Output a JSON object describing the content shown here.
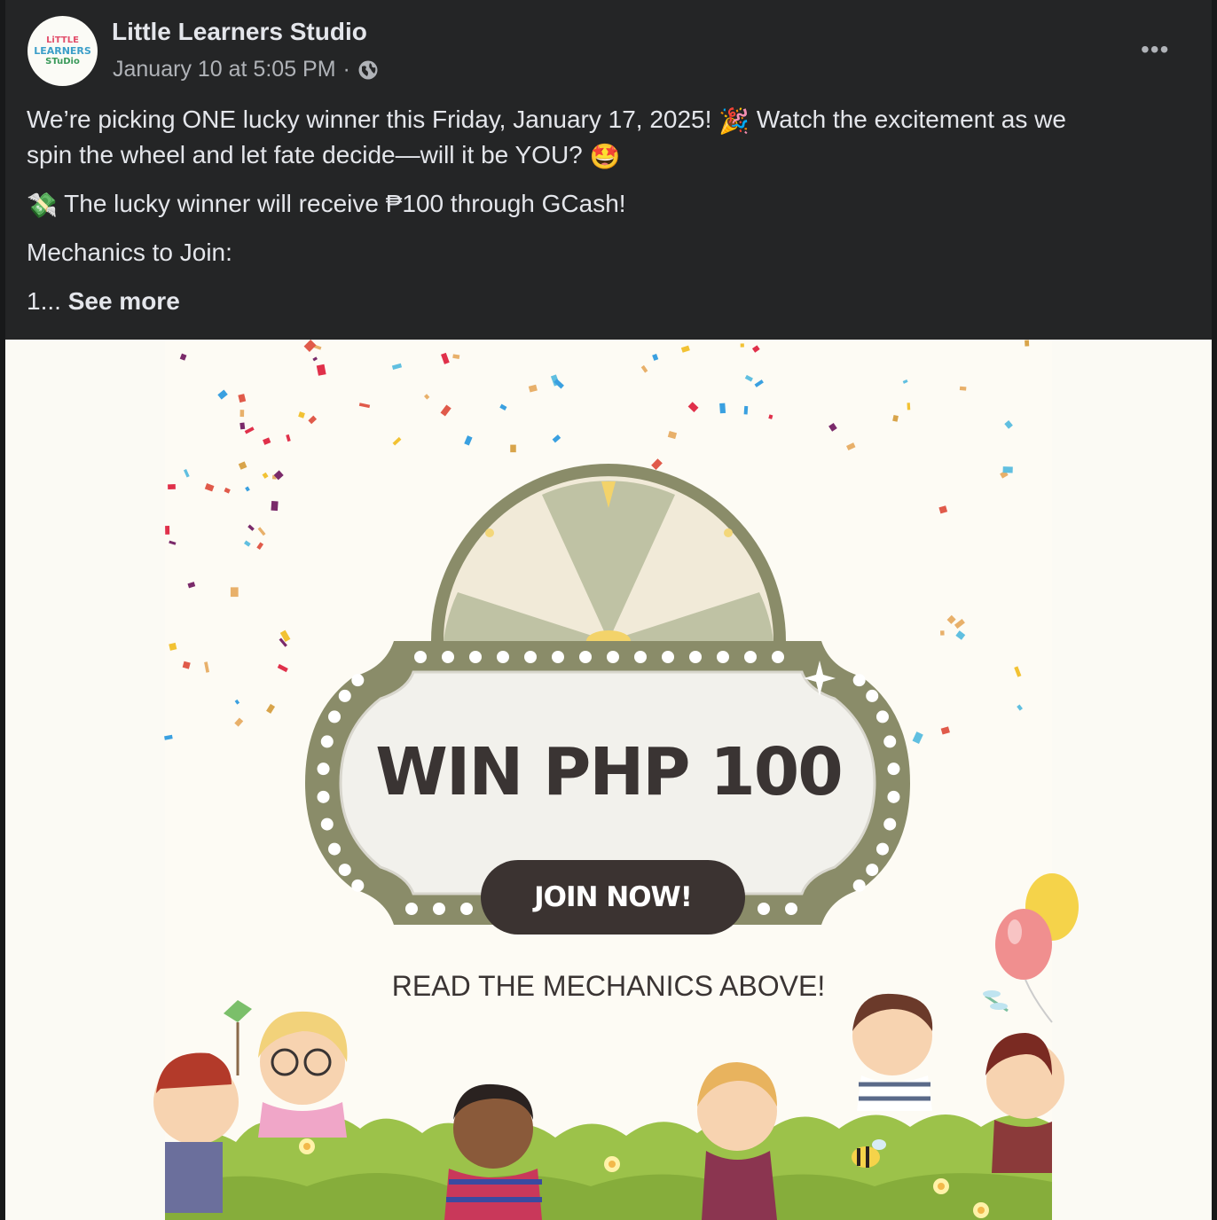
{
  "post": {
    "page_name": "Little Learners Studio",
    "avatar_text": [
      "LiTTLE",
      "LEARNERS",
      "STuDio"
    ],
    "timestamp": "January 10 at 5:05 PM",
    "separator": "·",
    "more_label": "•••",
    "line1": "We’re picking ONE lucky winner this Friday, January 17, 2025!",
    "line1_emoji": "🎉",
    "line1_end": "Watch the excitement as we",
    "line2": "spin the wheel and let fate decide—will it be YOU?",
    "line2_emoji": "🤩",
    "prize_emoji": "💸",
    "prize_line": "The lucky winner will receive ₱100 through GCash!",
    "mechanics_line": "Mechanics to Join:",
    "truncated_prefix": "1...",
    "see_more": "See more"
  },
  "image": {
    "headline": "WIN PHP 100",
    "button_label": "JOIN NOW!",
    "footer_text": "READ THE MECHANICS ABOVE!"
  },
  "colors": {
    "post_bg": "#242526",
    "image_bg": "#fbfaf4",
    "wheel_frame": "#8a8c69",
    "dark_brown": "#3b3331",
    "grass": "#9cc24a"
  }
}
